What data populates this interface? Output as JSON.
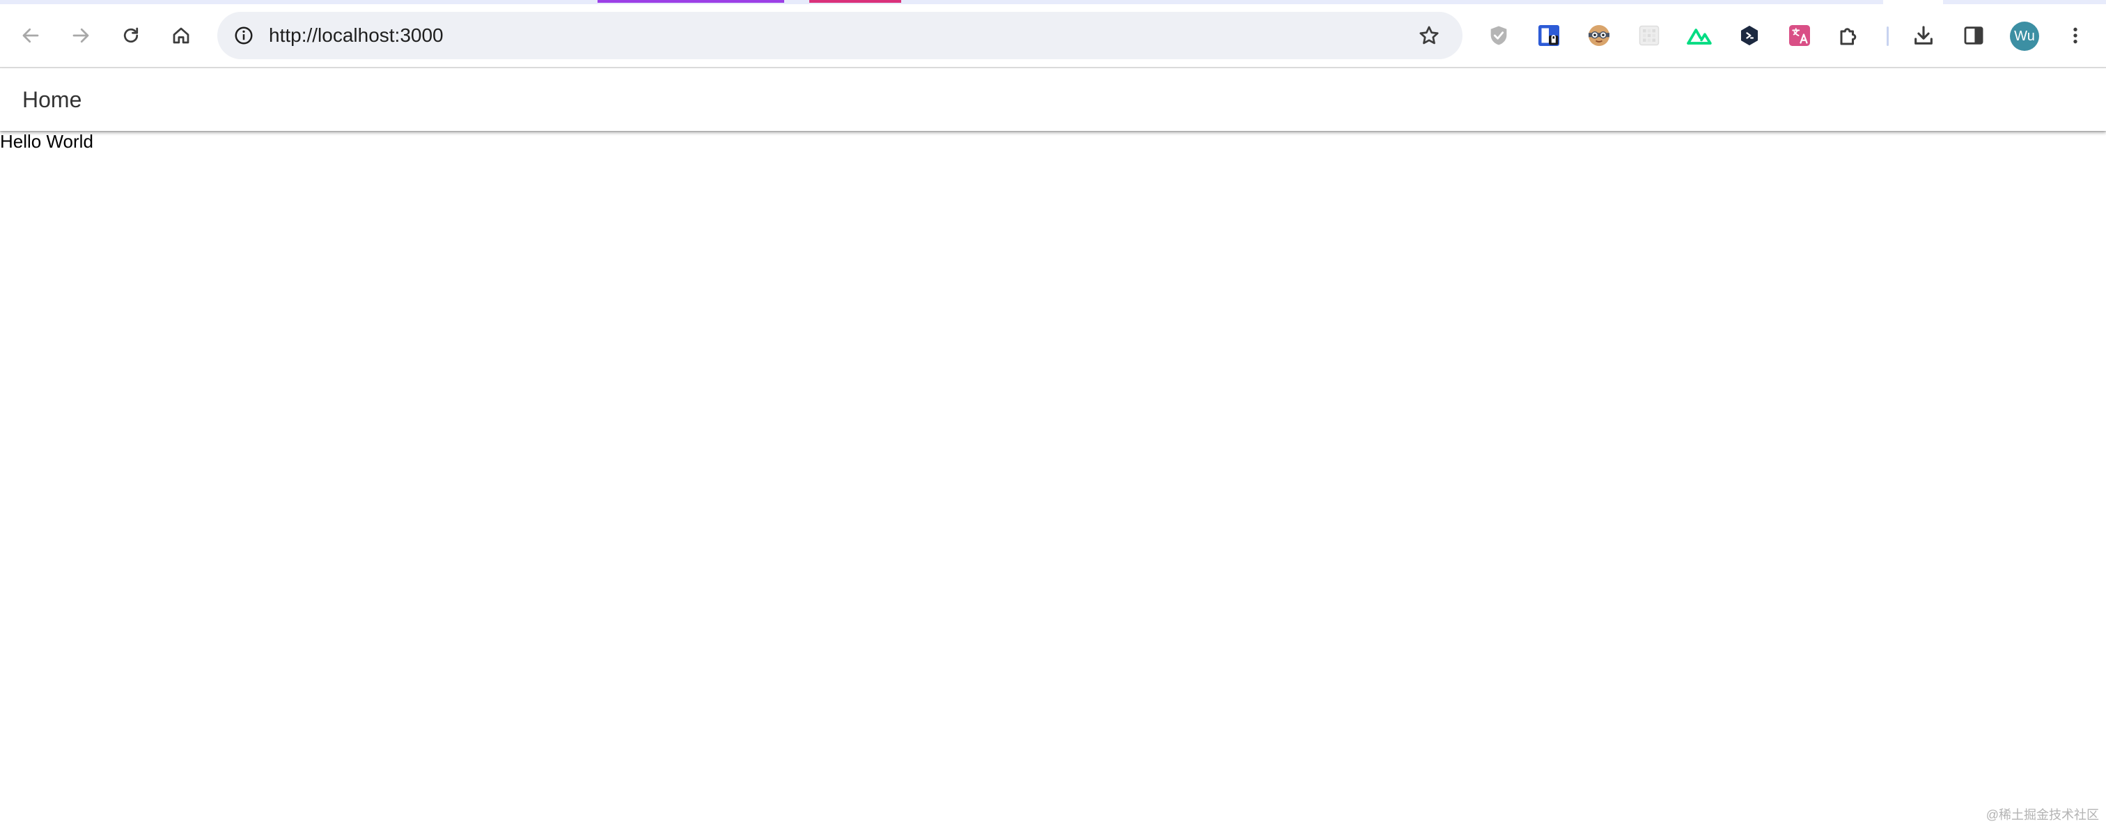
{
  "browser": {
    "colors": {
      "tab_indicator_1": "#9c3fe6",
      "tab_indicator_2": "#d9317a",
      "omnibox_bg": "#eef0f5",
      "avatar_bg": "#3c8fa3"
    },
    "nav": {
      "back_icon": "arrow-left-icon",
      "forward_icon": "arrow-right-icon",
      "reload_icon": "reload-icon",
      "home_icon": "home-icon"
    },
    "omnibox": {
      "url": "http://localhost:3000",
      "site_info_icon": "info-icon",
      "bookmark_icon": "star-icon"
    },
    "extensions": [
      "shield-icon",
      "password-manager-icon",
      "owl-face-icon",
      "grid-icon",
      "nuxt-icon",
      "hexagon-icon",
      "translate-icon",
      "puzzle-icon"
    ],
    "tools": {
      "download_icon": "download-icon",
      "side_panel_icon": "side-panel-icon",
      "menu_icon": "kebab-menu-icon"
    },
    "profile": {
      "initials": "Wu"
    }
  },
  "page": {
    "header_title": "Home",
    "body_text": "Hello World"
  },
  "watermark": "@稀土掘金技术社区"
}
